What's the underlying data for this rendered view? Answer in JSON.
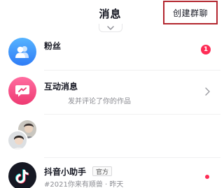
{
  "header": {
    "title": "消息",
    "create_group_label": "创建群聊"
  },
  "rows": [
    {
      "title": "粉丝",
      "badge": "1"
    },
    {
      "title": "互动消息",
      "subtitle": "发并评论了你的作品"
    },
    {
      "title": ""
    },
    {
      "title": "抖音小助手",
      "tag": "官方",
      "subtitle": "#2021你来有顺兽 · 昨天"
    }
  ],
  "icons": {
    "pull_tab": "chevron-down-icon",
    "fans": "users-icon",
    "interact": "message-icon",
    "interact_row_action": "chevron-right-icon",
    "assistant": "tiktok-logo-icon"
  },
  "colors": {
    "accent_red": "#fe2c55",
    "fans_blue": "#2f7cf6",
    "interact_pink": "#ee3a72",
    "highlight_border": "#b3262f"
  }
}
